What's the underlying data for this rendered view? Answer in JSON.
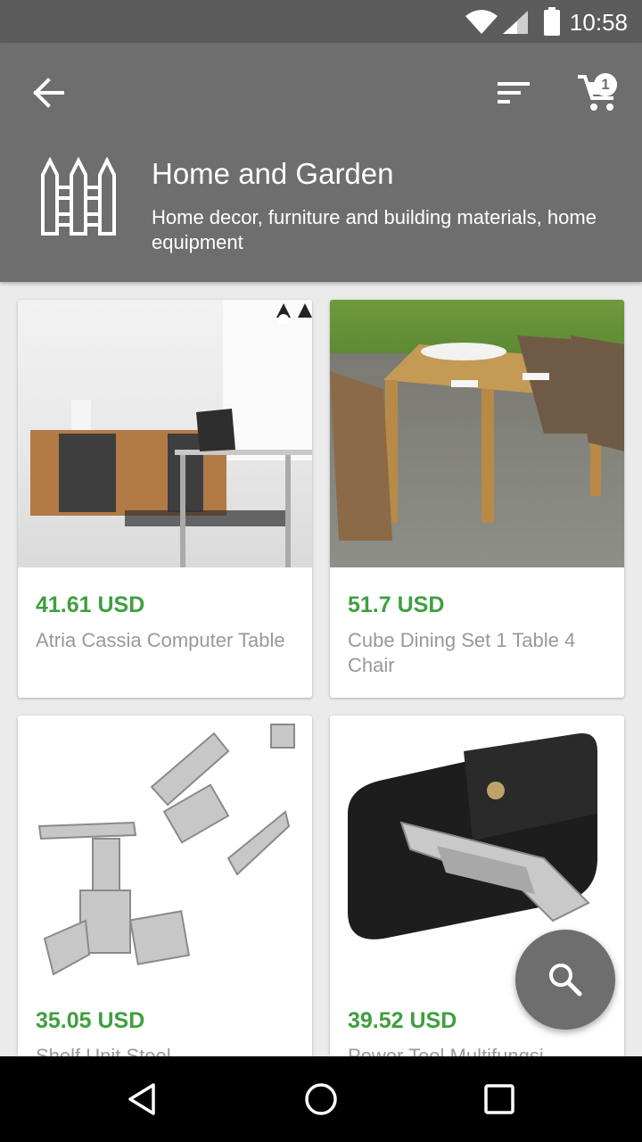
{
  "status_bar": {
    "time": "10:58"
  },
  "header": {
    "cart_count": "1",
    "category_title": "Home and Garden",
    "category_description": "Home decor, furniture and building materials, home equipment"
  },
  "products": [
    {
      "price": "41.61 USD",
      "name": "Atria Cassia Computer Table"
    },
    {
      "price": "51.7 USD",
      "name": "Cube Dining Set 1 Table 4 Chair"
    },
    {
      "price": "35.05 USD",
      "name": "Shelf Unit Steel"
    },
    {
      "price": "39.52 USD",
      "name": "Power Tool Multifungsi"
    }
  ],
  "colors": {
    "accent": "#3f9f3f",
    "header": "#6e6e6e",
    "statusbar": "#5c5c5c"
  }
}
